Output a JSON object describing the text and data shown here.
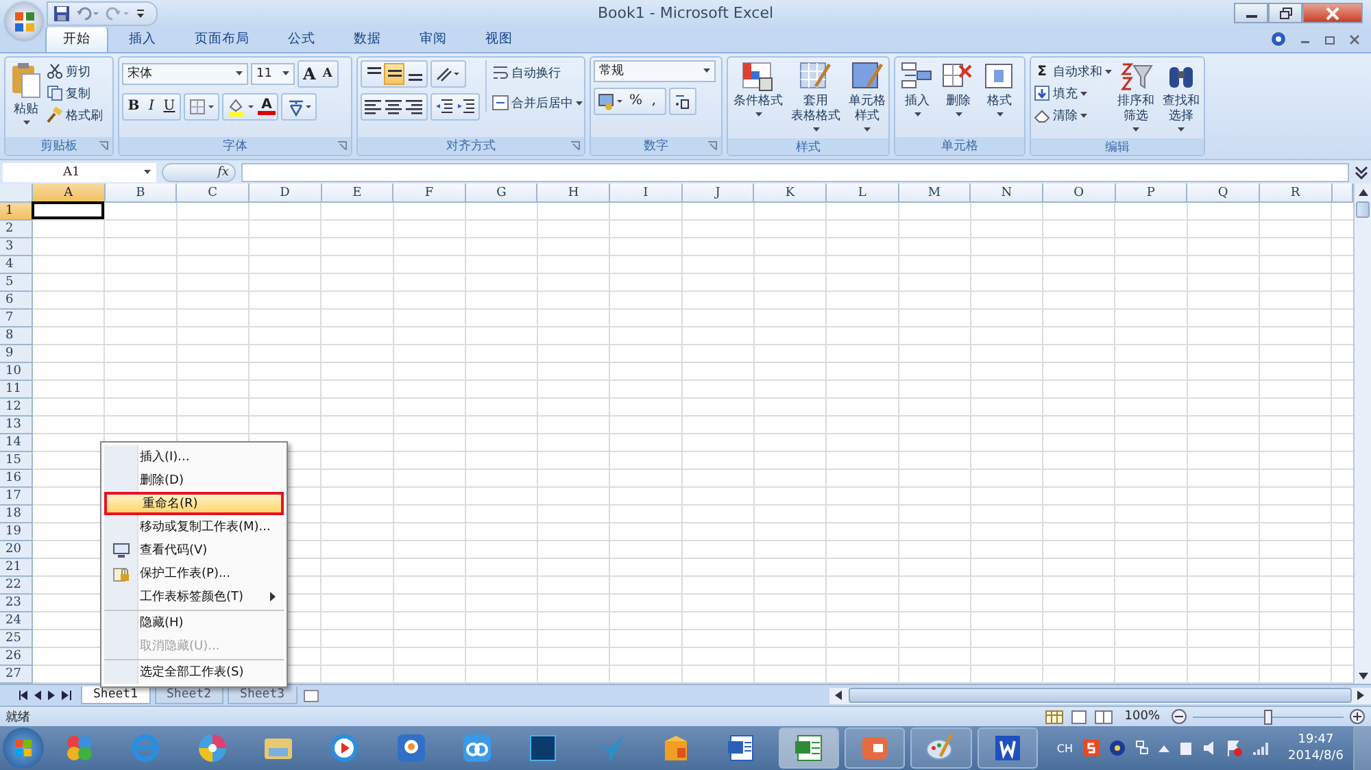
{
  "window": {
    "title": "Book1 - Microsoft Excel"
  },
  "tabs": [
    {
      "label": "开始",
      "selected": true
    },
    {
      "label": "插入",
      "selected": false
    },
    {
      "label": "页面布局",
      "selected": false
    },
    {
      "label": "公式",
      "selected": false
    },
    {
      "label": "数据",
      "selected": false
    },
    {
      "label": "审阅",
      "selected": false
    },
    {
      "label": "视图",
      "selected": false
    }
  ],
  "ribbon": {
    "clipboard": {
      "name": "剪贴板",
      "paste": "粘贴",
      "items": [
        {
          "kind": "cut",
          "label": "剪切"
        },
        {
          "kind": "copy",
          "label": "复制"
        },
        {
          "kind": "brush",
          "label": "格式刷"
        }
      ]
    },
    "font": {
      "name": "字体",
      "font_name": "宋体",
      "font_size": "11",
      "grow": "A",
      "shrink": "A",
      "styles": [
        "B",
        "I",
        "U"
      ],
      "font_color_letter": "A"
    },
    "alignment": {
      "name": "对齐方式",
      "vertical": [
        {
          "selected": false
        },
        {
          "selected": true
        },
        {
          "selected": false
        }
      ],
      "wrap": "自动换行",
      "merge": "合并后居中"
    },
    "number": {
      "name": "数字",
      "format": "常规",
      "percent": "%",
      "comma": ","
    },
    "styles": {
      "name": "样式",
      "buttons": [
        {
          "kind": "conditional",
          "lines": [
            "条件格式"
          ]
        },
        {
          "kind": "table",
          "lines": [
            "套用",
            "表格格式"
          ]
        },
        {
          "kind": "cellstyle",
          "lines": [
            "单元格",
            "样式"
          ]
        }
      ]
    },
    "cells": {
      "name": "单元格",
      "buttons": [
        {
          "kind": "insert",
          "label": "插入"
        },
        {
          "kind": "delete",
          "label": "删除"
        },
        {
          "kind": "format",
          "label": "格式"
        }
      ]
    },
    "editing": {
      "name": "编辑",
      "sum_symbol": "Σ",
      "items": [
        {
          "kind": "sum",
          "label": "自动求和"
        },
        {
          "kind": "fill",
          "label": "填充"
        },
        {
          "kind": "clear",
          "label": "清除"
        }
      ],
      "big": [
        {
          "kind": "sort",
          "lines": [
            "排序和",
            "筛选"
          ]
        },
        {
          "kind": "find",
          "lines": [
            "查找和",
            "选择"
          ]
        }
      ]
    }
  },
  "formula_bar": {
    "name_box": "A1",
    "fx": "fx"
  },
  "columns": [
    {
      "label": "A",
      "selected": true
    },
    {
      "label": "B",
      "selected": false
    },
    {
      "label": "C",
      "selected": false
    },
    {
      "label": "D",
      "selected": false
    },
    {
      "label": "E",
      "selected": false
    },
    {
      "label": "F",
      "selected": false
    },
    {
      "label": "G",
      "selected": false
    },
    {
      "label": "H",
      "selected": false
    },
    {
      "label": "I",
      "selected": false
    },
    {
      "label": "J",
      "selected": false
    },
    {
      "label": "K",
      "selected": false
    },
    {
      "label": "L",
      "selected": false
    },
    {
      "label": "M",
      "selected": false
    },
    {
      "label": "N",
      "selected": false
    },
    {
      "label": "O",
      "selected": false
    },
    {
      "label": "P",
      "selected": false
    },
    {
      "label": "Q",
      "selected": false
    },
    {
      "label": "R",
      "selected": false
    }
  ],
  "rows": [
    {
      "label": "1",
      "selected": true
    },
    {
      "label": "2",
      "selected": false
    },
    {
      "label": "3",
      "selected": false
    },
    {
      "label": "4",
      "selected": false
    },
    {
      "label": "5",
      "selected": false
    },
    {
      "label": "6",
      "selected": false
    },
    {
      "label": "7",
      "selected": false
    },
    {
      "label": "8",
      "selected": false
    },
    {
      "label": "9",
      "selected": false
    },
    {
      "label": "10",
      "selected": false
    },
    {
      "label": "11",
      "selected": false
    },
    {
      "label": "12",
      "selected": false
    },
    {
      "label": "13",
      "selected": false
    },
    {
      "label": "14",
      "selected": false
    },
    {
      "label": "15",
      "selected": false
    },
    {
      "label": "16",
      "selected": false
    },
    {
      "label": "17",
      "selected": false
    },
    {
      "label": "18",
      "selected": false
    },
    {
      "label": "19",
      "selected": false
    },
    {
      "label": "20",
      "selected": false
    },
    {
      "label": "21",
      "selected": false
    },
    {
      "label": "22",
      "selected": false
    },
    {
      "label": "23",
      "selected": false
    },
    {
      "label": "24",
      "selected": false
    },
    {
      "label": "25",
      "selected": false
    },
    {
      "label": "26",
      "selected": false
    },
    {
      "label": "27",
      "selected": false
    }
  ],
  "context_menu": [
    {
      "kind": "command",
      "label": "插入(I)...",
      "disabled": false,
      "selected": false,
      "submenu": false,
      "separator_before": false
    },
    {
      "kind": "command",
      "label": "删除(D)",
      "disabled": false,
      "selected": false,
      "submenu": false,
      "separator_before": false
    },
    {
      "kind": "command",
      "label": "重命名(R)",
      "disabled": false,
      "selected": true,
      "submenu": false,
      "separator_before": false
    },
    {
      "kind": "command",
      "label": "移动或复制工作表(M)...",
      "disabled": false,
      "selected": false,
      "submenu": false,
      "separator_before": false
    },
    {
      "kind": "code",
      "label": "查看代码(V)",
      "disabled": false,
      "selected": false,
      "submenu": false,
      "separator_before": false
    },
    {
      "kind": "lock",
      "label": "保护工作表(P)...",
      "disabled": false,
      "selected": false,
      "submenu": false,
      "separator_before": false
    },
    {
      "kind": "command",
      "label": "工作表标签颜色(T)",
      "disabled": false,
      "selected": false,
      "submenu": true,
      "separator_before": false
    },
    {
      "kind": "command",
      "label": "隐藏(H)",
      "disabled": false,
      "selected": false,
      "submenu": false,
      "separator_before": true
    },
    {
      "kind": "command",
      "label": "取消隐藏(U)...",
      "disabled": true,
      "selected": false,
      "submenu": false,
      "separator_before": false
    },
    {
      "kind": "command",
      "label": "选定全部工作表(S)",
      "disabled": false,
      "selected": false,
      "submenu": false,
      "separator_before": true
    }
  ],
  "sheet_tabs": [
    {
      "label": "Sheet1",
      "selected": true
    },
    {
      "label": "Sheet2",
      "selected": false
    },
    {
      "label": "Sheet3",
      "selected": false
    }
  ],
  "status_bar": {
    "text": "就绪",
    "zoom": "100%",
    "zoom_slider": {
      "level": 0.5
    }
  },
  "taskbar": {
    "apps": [
      {
        "kind": "balls",
        "running": false,
        "selected": false
      },
      {
        "kind": "browser",
        "running": false,
        "selected": false
      },
      {
        "kind": "pinwheel",
        "running": false,
        "selected": false
      },
      {
        "kind": "folder",
        "running": false,
        "selected": false
      },
      {
        "kind": "player",
        "running": false,
        "selected": false
      },
      {
        "kind": "pp",
        "running": false,
        "selected": false
      },
      {
        "kind": "cloud",
        "running": false,
        "selected": false
      },
      {
        "kind": "ps",
        "running": false,
        "selected": false
      },
      {
        "kind": "bird",
        "running": false,
        "selected": false
      },
      {
        "kind": "box",
        "running": false,
        "selected": false
      },
      {
        "kind": "word",
        "running": false,
        "selected": false
      },
      {
        "kind": "excel",
        "running": true,
        "selected": true
      },
      {
        "kind": "ppt",
        "running": true,
        "selected": false
      },
      {
        "kind": "paint",
        "running": true,
        "selected": false
      },
      {
        "kind": "wps",
        "running": true,
        "selected": false
      }
    ],
    "input_method": "CH",
    "time": "19:47",
    "date": "2014/8/6"
  }
}
